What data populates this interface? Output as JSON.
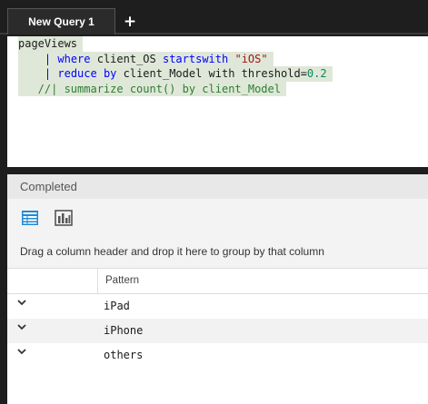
{
  "tabs": [
    {
      "label": "New Query 1",
      "active": true
    }
  ],
  "add_tab": {
    "label": "+"
  },
  "editor": {
    "lines": [
      [
        {
          "t": "pageViews",
          "c": "c-default"
        }
      ],
      [
        {
          "t": "    ",
          "c": "c-default"
        },
        {
          "t": "|",
          "c": "c-op"
        },
        {
          "t": " ",
          "c": "c-default"
        },
        {
          "t": "where",
          "c": "c-kw"
        },
        {
          "t": " client_OS ",
          "c": "c-default"
        },
        {
          "t": "startswith",
          "c": "c-kw"
        },
        {
          "t": " ",
          "c": "c-default"
        },
        {
          "t": "\"iOS\"",
          "c": "c-str"
        }
      ],
      [
        {
          "t": "    ",
          "c": "c-default"
        },
        {
          "t": "|",
          "c": "c-op"
        },
        {
          "t": " ",
          "c": "c-default"
        },
        {
          "t": "reduce by",
          "c": "c-kw"
        },
        {
          "t": " client_Model with threshold=",
          "c": "c-default"
        },
        {
          "t": "0.2",
          "c": "c-num"
        }
      ],
      [
        {
          "t": "   //| summarize count() by client_Model",
          "c": "c-comment"
        }
      ]
    ]
  },
  "results": {
    "status": "Completed",
    "group_hint": "Drag a column header and drop it here to group by that column",
    "columns": [
      "Pattern"
    ],
    "rows": [
      {
        "Pattern": "iPad"
      },
      {
        "Pattern": "iPhone"
      },
      {
        "Pattern": "others"
      }
    ]
  },
  "icons": {
    "table_view": "table-view-icon",
    "chart_view": "chart-view-icon",
    "expand": "chevron-down-icon"
  },
  "colors": {
    "accent": "#1f8ad2",
    "code_highlight": "#dfe8d8",
    "keyword": "#0000ff",
    "string": "#a31515",
    "number": "#098658",
    "comment": "#2e7d32"
  }
}
